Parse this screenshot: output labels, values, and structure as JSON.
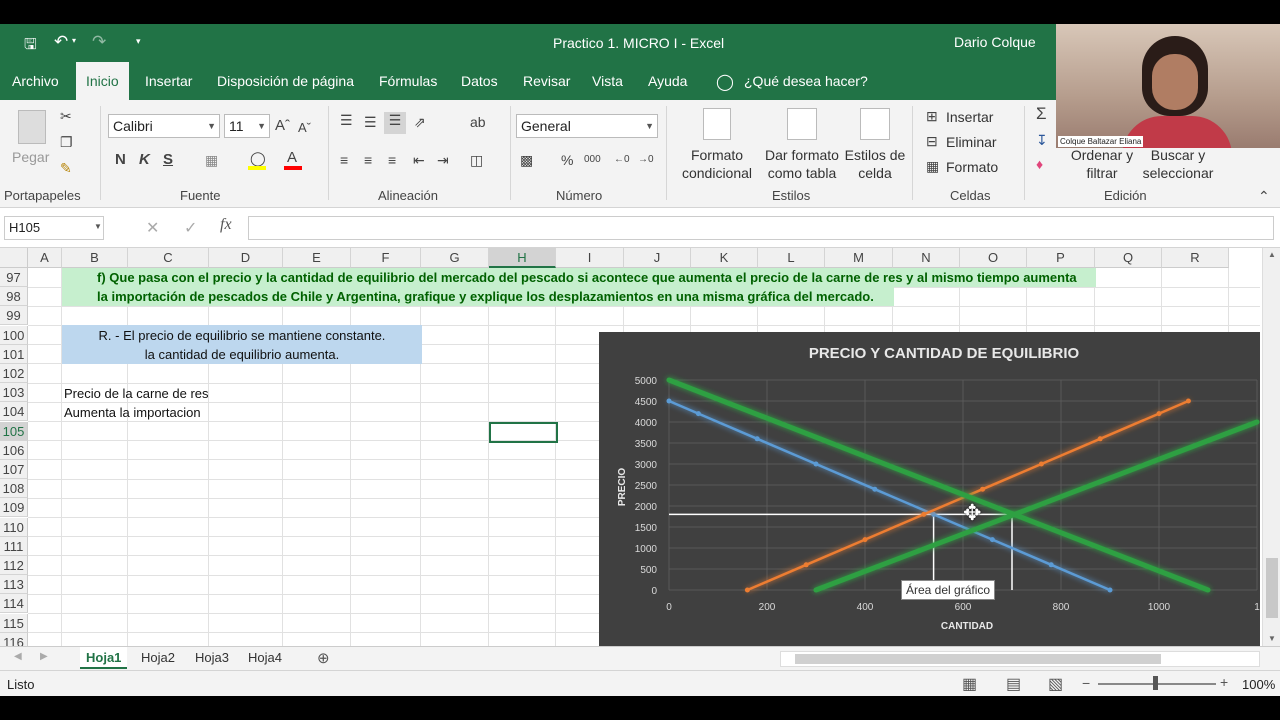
{
  "titlebar": {
    "doc_title": "Practico 1. MICRO I  -  Excel",
    "user": "Dario Colque"
  },
  "tabs": [
    "Archivo",
    "Inicio",
    "Insertar",
    "Disposición de página",
    "Fórmulas",
    "Datos",
    "Revisar",
    "Vista",
    "Ayuda"
  ],
  "tell_me": "¿Qué desea hacer?",
  "ribbon": {
    "paste": "Pegar",
    "font_name": "Calibri",
    "font_size": "11",
    "bold": "N",
    "italic": "K",
    "underline": "S",
    "number_format": "General",
    "cond_format": "Formato condicional",
    "format_table": "Dar formato como tabla",
    "cell_styles": "Estilos de celda",
    "insert": "Insertar",
    "delete": "Eliminar",
    "format": "Formato",
    "sort_filter": "Ordenar y filtrar",
    "find_select": "Buscar y seleccionar",
    "groups": {
      "clipboard": "Portapapeles",
      "font": "Fuente",
      "alignment": "Alineación",
      "number": "Número",
      "styles": "Estilos",
      "cells": "Celdas",
      "editing": "Edición"
    }
  },
  "formula_bar": {
    "name_box": "H105",
    "formula": ""
  },
  "columns": [
    "A",
    "B",
    "C",
    "D",
    "E",
    "F",
    "G",
    "H",
    "I",
    "J",
    "K",
    "L",
    "M",
    "N",
    "O",
    "P",
    "Q",
    "R"
  ],
  "rows": [
    "97",
    "98",
    "99",
    "100",
    "101",
    "102",
    "103",
    "104",
    "105",
    "106",
    "107",
    "108",
    "109",
    "110",
    "111",
    "112",
    "113",
    "114",
    "115",
    "116"
  ],
  "cells": {
    "q_line1": "f) Que pasa con el precio y la cantidad de equilibrio del mercado del pescado si acontece que aumenta el precio de la carne de res y al mismo tiempo aumenta",
    "q_line2": "la importación de pescados de Chile y Argentina, grafique y explique los desplazamientos en una misma gráfica del mercado.",
    "a_line1": "R. - El precio de equilibrio se mantiene constante.",
    "a_line2": "la cantidad de equilibrio aumenta.",
    "b103": "Precio de la  carne de res",
    "b104": "Aumenta la importacion"
  },
  "chart_data": {
    "type": "line",
    "title": "PRECIO Y CANTIDAD DE EQUILIBRIO",
    "xlabel": "CANTIDAD",
    "ylabel": "PRECIO",
    "xlim": [
      0,
      1200
    ],
    "ylim": [
      0,
      5000
    ],
    "xticks": [
      "0",
      "200",
      "400",
      "600",
      "800",
      "1000",
      "1"
    ],
    "yticks": [
      "0",
      "500",
      "1000",
      "1500",
      "2000",
      "2500",
      "3000",
      "3500",
      "4000",
      "4500",
      "5000"
    ],
    "series": [
      {
        "color": "#5b9bd5",
        "x": [
          0,
          60,
          180,
          300,
          420,
          540,
          660,
          780,
          900
        ],
        "y": [
          4500,
          4200,
          3600,
          3000,
          2400,
          1800,
          1200,
          600,
          0
        ]
      },
      {
        "color": "#ed7d31",
        "x": [
          160,
          280,
          400,
          520,
          640,
          760,
          880,
          1000,
          1060
        ],
        "y": [
          0,
          600,
          1200,
          1800,
          2400,
          3000,
          3600,
          4200,
          4500
        ]
      },
      {
        "color": "#2ea043",
        "x": [
          0,
          1100
        ],
        "y": [
          5000,
          0
        ]
      },
      {
        "color": "#2ea043",
        "x": [
          300,
          1200
        ],
        "y": [
          0,
          4000
        ]
      }
    ],
    "tooltip": "Área del gráfico",
    "guide": {
      "price": 1800,
      "q_old": 540,
      "q_new": 700
    }
  },
  "sheets": [
    "Hoja1",
    "Hoja2",
    "Hoja3",
    "Hoja4"
  ],
  "status": {
    "ready": "Listo",
    "zoom": "100%"
  },
  "webcam": {
    "name": "Colque Baltazar Eliana"
  }
}
